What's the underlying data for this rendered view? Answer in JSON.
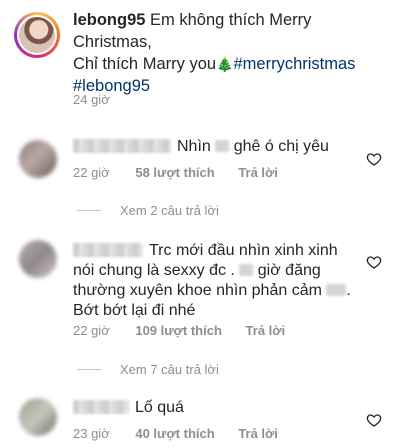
{
  "caption": {
    "username": "lebong95",
    "text_line1": "Em không thích Merry",
    "text_line2": "Christmas,",
    "text_line3": "Chỉ thích Marry you",
    "tree_emoji": "🎄",
    "hashtag1": "#merrychristmas",
    "hashtag2": "#lebong95",
    "time": "24 giờ"
  },
  "comments": [
    {
      "lines": [
        "Nhìn",
        "ghê ó chị yêu"
      ],
      "time": "22 giờ",
      "likes": "58 lượt thích",
      "reply": "Trả lời",
      "view_replies": "Xem 2 câu trả lời"
    },
    {
      "lines": [
        "Trc mới đầu nhìn xinh xinh",
        "nói chung là sexxy đc .",
        "giờ đăng",
        "thường xuyên khoe nhìn phản cảm",
        ".",
        "Bớt bớt lại đi nhé"
      ],
      "time": "22 giờ",
      "likes": "109 lượt thích",
      "reply": "Trả lời",
      "view_replies": "Xem 7 câu trả lời"
    },
    {
      "lines": [
        "Lố quá"
      ],
      "time": "23 giờ",
      "likes": "40 lượt thích",
      "reply": "Trả lời"
    }
  ],
  "icons": {
    "like": "heart-outline-icon"
  },
  "colors": {
    "hashtag": "#003569",
    "secondary_text": "#8e8e8e",
    "primary_text": "#262626"
  }
}
